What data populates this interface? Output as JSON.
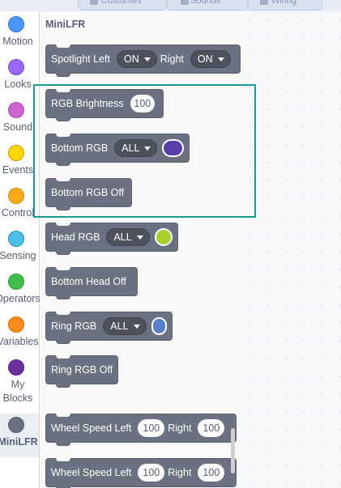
{
  "top_tabs": [
    {
      "label": "Costumes",
      "icon": "costume-icon"
    },
    {
      "label": "Sounds",
      "icon": "speaker-icon"
    },
    {
      "label": "Wiring",
      "icon": "wiring-icon"
    }
  ],
  "categories": [
    {
      "label": "Motion",
      "color": "#4c97ff"
    },
    {
      "label": "Looks",
      "color": "#9966ff"
    },
    {
      "label": "Sound",
      "color": "#cf63cf"
    },
    {
      "label": "Events",
      "color": "#ffd500"
    },
    {
      "label": "Control",
      "color": "#ffab19"
    },
    {
      "label": "Sensing",
      "color": "#4cbfe6"
    },
    {
      "label": "Operators",
      "color": "#40bf4a"
    },
    {
      "label": "Variables",
      "color": "#ff8c1a"
    },
    {
      "label": "My Blocks",
      "color": "#6e2f9e"
    },
    {
      "label": "MiniLFR",
      "color": "#6b7180",
      "selected": true
    }
  ],
  "flyout": {
    "title": "MiniLFR",
    "blocks": {
      "spotlight": {
        "label": "Spotlight Left",
        "left_value": "ON",
        "right_label": "Right",
        "right_value": "ON"
      },
      "rgb_brightness": {
        "label": "RGB Brightness",
        "value": "100"
      },
      "bottom_rgb": {
        "label": "Bottom RGB",
        "target": "ALL",
        "color": "#5b3fa8"
      },
      "bottom_rgb_off": {
        "label": "Bottom RGB Off"
      },
      "head_rgb": {
        "label": "Head RGB",
        "target": "ALL",
        "color": "#a6d12f"
      },
      "bottom_head_off": {
        "label": "Bottom Head Off"
      },
      "ring_rgb": {
        "label": "Ring RGB",
        "target": "ALL",
        "color": "#5b80c9"
      },
      "ring_rgb_off": {
        "label": "Ring RGB Off"
      },
      "wheel_speed_1": {
        "label": "Wheel Speed Left",
        "left_value": "100",
        "right_label": "Right",
        "right_value": "100"
      },
      "wheel_speed_2": {
        "label": "Wheel Speed Left",
        "left_value": "100",
        "right_label": "Right",
        "right_value": "100"
      }
    }
  },
  "highlight_color": "#1a9a94"
}
